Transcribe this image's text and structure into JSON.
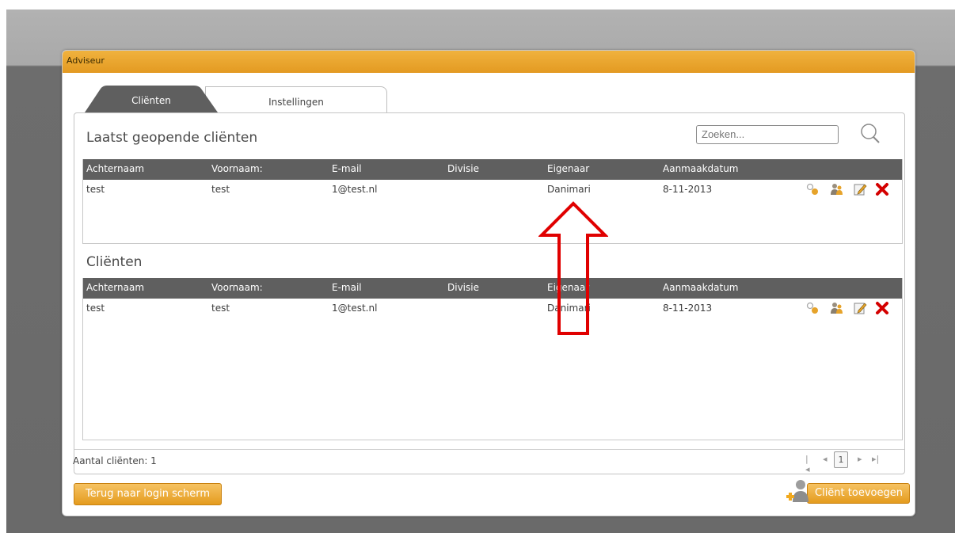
{
  "window": {
    "title": "Adviseur"
  },
  "tabs": [
    {
      "label": "Cliënten",
      "active": true
    },
    {
      "label": "Instellingen",
      "active": false
    }
  ],
  "recent": {
    "title": "Laatst geopende cliënten"
  },
  "search": {
    "placeholder": "Zoeken..."
  },
  "columns": [
    "Achternaam",
    "Voornaam:",
    "E-mail",
    "Divisie",
    "Eigenaar",
    "Aanmaakdatum"
  ],
  "recent_rows": [
    {
      "achternaam": "test",
      "voornaam": "test",
      "email": "1@test.nl",
      "divisie": "",
      "eigenaar": "Danimari",
      "aanmaakdatum": "8-11-2013"
    }
  ],
  "clients": {
    "title": "Cliënten"
  },
  "client_rows": [
    {
      "achternaam": "test",
      "voornaam": "test",
      "email": "1@test.nl",
      "divisie": "",
      "eigenaar": "Danimari",
      "aanmaakdatum": "8-11-2013"
    }
  ],
  "row_actions": [
    "key-icon",
    "users-icon",
    "edit-icon",
    "delete-icon"
  ],
  "footer": {
    "count_label": "Aantal cliënten: 1"
  },
  "pager": {
    "first": "|◂",
    "prev": "◂",
    "page": "1",
    "next": "▸",
    "last": "▸|"
  },
  "buttons": {
    "back": "Terug naar login scherm",
    "add": "Cliënt toevoegen"
  },
  "colors": {
    "accent": "#e8a42d",
    "header": "#5f5f5f",
    "delete": "#d40000",
    "annotation": "#e00000"
  }
}
